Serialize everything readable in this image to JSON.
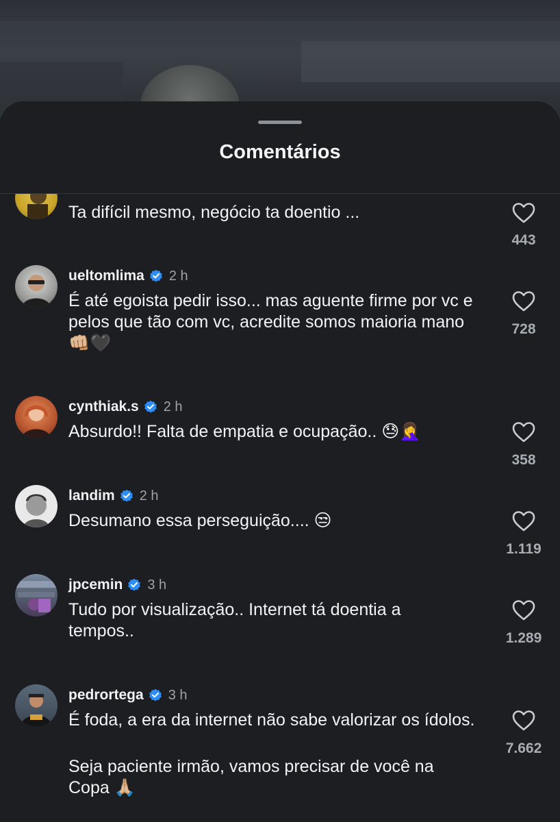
{
  "sheet": {
    "title": "Comentários"
  },
  "comments": [
    {
      "username": "",
      "time": "",
      "text": "Ta difícil mesmo, negócio ta doentio ...",
      "likes": "443"
    },
    {
      "username": "ueltomlima",
      "time": "2 h",
      "text": "É até egoista pedir isso... mas aguente firme por vc e pelos que tão com vc, acredite somos maioria mano 👊🏼🖤",
      "likes": "728"
    },
    {
      "username": "cynthiak.s",
      "time": "2 h",
      "text": "Absurdo!! Falta de empatia e ocupação.. 😓🤦‍♀️",
      "likes": "358"
    },
    {
      "username": "landim",
      "time": "2 h",
      "text": "Desumano essa perseguição.... 😒",
      "likes": "1.119"
    },
    {
      "username": "jpcemin",
      "time": "3 h",
      "text": "Tudo por visualização.. Internet tá doentia a tempos..",
      "likes": "1.289"
    },
    {
      "username": "pedrortega",
      "time": "3 h",
      "text": "É foda, a era da internet não sabe valorizar os ídolos.",
      "text2": "Seja paciente irmão, vamos precisar de você na Copa 🙏🏼",
      "likes": "7.662"
    }
  ],
  "colors": {
    "sheet_bg": "#1c1e22",
    "verified": "#2e8ef5",
    "muted_text": "#9ea3a9"
  },
  "icons": {
    "like": "heart-outline-icon",
    "verified": "verified-badge-icon"
  }
}
